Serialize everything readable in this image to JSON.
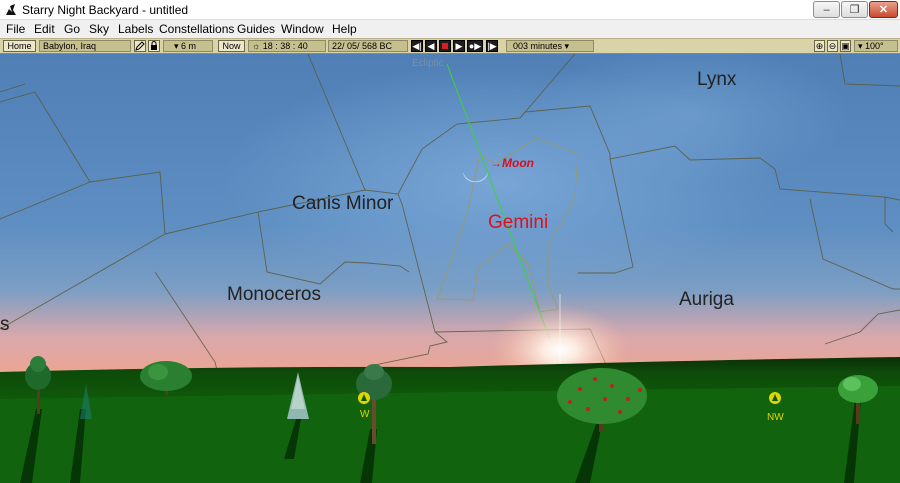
{
  "window": {
    "title": "Starry Night Backyard - untitled",
    "minimize_glyph": "–",
    "maximize_glyph": "❐",
    "close_glyph": "✕"
  },
  "menu": [
    "File",
    "Edit",
    "Go",
    "Sky",
    "Labels",
    "Constellations",
    "Guides",
    "Window",
    "Help"
  ],
  "toolbar": {
    "home_label": "Home",
    "location": "Babylon, Iraq",
    "elevation": "▾ 6 m",
    "now_label": "Now",
    "time": "18 : 38 : 40",
    "date": "22/ 05/   568 BC",
    "time_step": "003 minutes ▾",
    "fov": "▾ 100°",
    "colors": {
      "bar": "#d9d3a7",
      "field": "#c6bf8e",
      "stop": "#d42020"
    }
  },
  "sky": {
    "constellations": [
      "Lynx",
      "Canis Minor",
      "Gemini",
      "Monoceros",
      "Auriga"
    ],
    "partial_constellation": "s",
    "moon_label": "→Moon",
    "ecliptic_label": "Ecliptic",
    "compass": {
      "west": "W",
      "northwest": "NW"
    },
    "colors": {
      "sky_top": "#4f7fb5",
      "horizon_glow": "#f0a58d",
      "ground": "#0f5a0a",
      "highlight": "#e0101a",
      "ecliptic": "#3ad43a",
      "boundary": "#5a5a3a"
    }
  }
}
